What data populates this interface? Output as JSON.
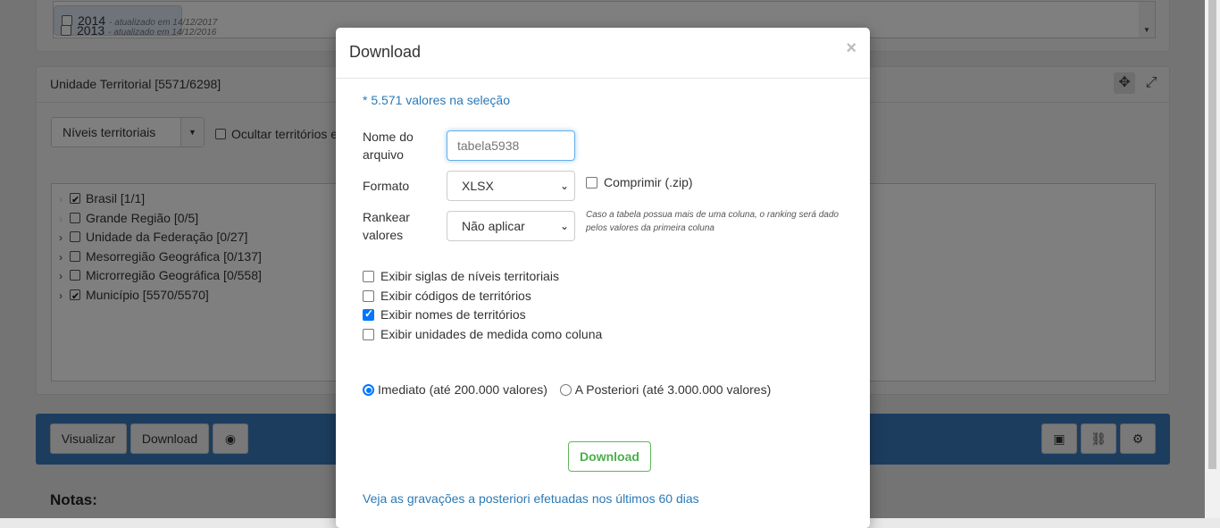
{
  "background": {
    "years": [
      {
        "year": "2014",
        "note": "- atualizado em 14/12/2017"
      },
      {
        "year": "2013",
        "note": "- atualizado em 14/12/2016"
      }
    ],
    "territorial_panel": {
      "title": "Unidade Territorial [5571/6298]",
      "select_value": "Níveis territoriais",
      "hide_label": "Ocultar territórios e",
      "tree": [
        {
          "label": "Brasil [1/1]",
          "checked": true,
          "expandable": false
        },
        {
          "label": "Grande Região [0/5]",
          "checked": false,
          "expandable": false
        },
        {
          "label": "Unidade da Federação [0/27]",
          "checked": false,
          "expandable": true
        },
        {
          "label": "Mesorregião Geográfica [0/137]",
          "checked": false,
          "expandable": true
        },
        {
          "label": "Microrregião Geográfica [0/558]",
          "checked": false,
          "expandable": true
        },
        {
          "label": "Município [5570/5570]",
          "checked": true,
          "expandable": true
        }
      ]
    },
    "toolbar": {
      "visualizar": "Visualizar",
      "download": "Download"
    },
    "notes_title": "Notas:"
  },
  "modal": {
    "title": "Download",
    "close": "×",
    "info": "* 5.571 valores na seleção",
    "filename_label": "Nome do arquivo",
    "filename_placeholder": "tabela5938",
    "format_label": "Formato",
    "format_value": "XLSX",
    "zip_label": "Comprimir (.zip)",
    "rank_label": "Rankear valores",
    "rank_value": "Não aplicar",
    "rank_hint": "Caso a tabela possua mais de uma coluna, o ranking será dado pelos valores da primeira coluna",
    "options": [
      {
        "label": "Exibir siglas de níveis territoriais",
        "checked": false
      },
      {
        "label": "Exibir códigos de territórios",
        "checked": false
      },
      {
        "label": "Exibir nomes de territórios",
        "checked": true
      },
      {
        "label": "Exibir unidades de medida como coluna",
        "checked": false
      }
    ],
    "radio_immediate": "Imediato (até 200.000 valores)",
    "radio_later": "A Posteriori (até 3.000.000 valores)",
    "download_button": "Download",
    "recordings_link": "Veja as gravações a posteriori efetuadas nos últimos 60 dias"
  },
  "colors": {
    "toolbar": "#3b7bbf",
    "link": "#2b7ab6",
    "success": "#5cb85c",
    "checkbox_accent": "#0075ff"
  }
}
